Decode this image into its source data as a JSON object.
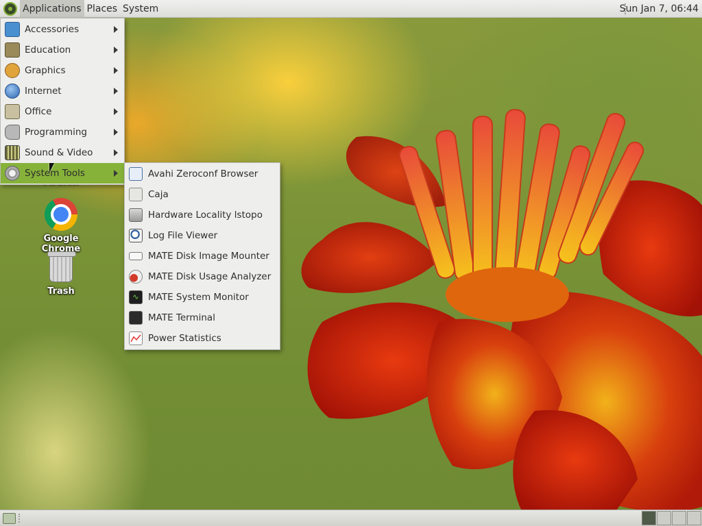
{
  "top_panel": {
    "menus": [
      "Applications",
      "Places",
      "System"
    ],
    "clock": "Sun Jan  7, 06:44"
  },
  "desktop": {
    "icons": [
      {
        "label": "Firefox",
        "icon": "firefox-icon"
      },
      {
        "label": "Google Chrome",
        "icon": "chrome-icon"
      },
      {
        "label": "Trash",
        "icon": "trash-icon"
      }
    ]
  },
  "applications_menu": {
    "items": [
      {
        "label": "Accessories",
        "icon": "accessories-icon",
        "has_submenu": true
      },
      {
        "label": "Education",
        "icon": "education-icon",
        "has_submenu": true
      },
      {
        "label": "Graphics",
        "icon": "graphics-icon",
        "has_submenu": true
      },
      {
        "label": "Internet",
        "icon": "internet-globe-icon",
        "has_submenu": true
      },
      {
        "label": "Office",
        "icon": "office-icon",
        "has_submenu": true
      },
      {
        "label": "Programming",
        "icon": "programming-icon",
        "has_submenu": true
      },
      {
        "label": "Sound & Video",
        "icon": "sound-video-icon",
        "has_submenu": true
      },
      {
        "label": "System Tools",
        "icon": "system-tools-gear-icon",
        "has_submenu": true,
        "highlighted": true
      }
    ]
  },
  "system_tools_submenu": {
    "items": [
      {
        "label": "Avahi Zeroconf Browser",
        "icon": "avahi-icon"
      },
      {
        "label": "Caja",
        "icon": "caja-icon"
      },
      {
        "label": "Hardware Locality lstopo",
        "icon": "hardware-icon"
      },
      {
        "label": "Log File Viewer",
        "icon": "log-viewer-icon"
      },
      {
        "label": "MATE Disk Image Mounter",
        "icon": "disk-image-icon"
      },
      {
        "label": "MATE Disk Usage Analyzer",
        "icon": "disk-usage-icon"
      },
      {
        "label": "MATE System Monitor",
        "icon": "system-monitor-icon"
      },
      {
        "label": "MATE Terminal",
        "icon": "terminal-icon"
      },
      {
        "label": "Power Statistics",
        "icon": "power-statistics-icon"
      }
    ]
  },
  "colors": {
    "highlight": "#86b23a",
    "menu_bg": "#eeeeec",
    "panel_bg": "#dcdcd8"
  },
  "bottom_panel": {
    "workspaces": 4,
    "active_workspace": 1
  }
}
